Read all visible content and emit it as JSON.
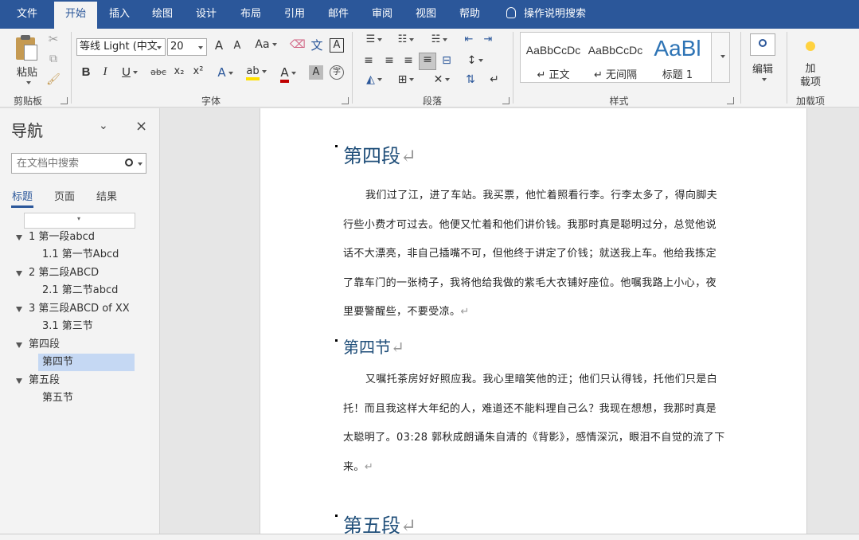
{
  "menu": {
    "tabs": [
      "文件",
      "开始",
      "插入",
      "绘图",
      "设计",
      "布局",
      "引用",
      "邮件",
      "审阅",
      "视图",
      "帮助"
    ],
    "active_tab": "开始",
    "tell_me": "操作说明搜索"
  },
  "ribbon": {
    "clipboard": {
      "paste_label": "粘贴",
      "group_label": "剪贴板"
    },
    "font": {
      "font_name": "等线 Light (中文",
      "font_size": "20",
      "grow": "A",
      "shrink": "A",
      "change_case": "Aa",
      "phonetic": "文",
      "border": "A",
      "bold": "B",
      "italic": "I",
      "underline": "U",
      "strikethrough": "abc",
      "subscript": "x₂",
      "superscript": "x²",
      "text_effects": "A",
      "highlight": "ab",
      "font_color": "A",
      "char_shading": "A",
      "enclose": "字",
      "group_label": "字体"
    },
    "paragraph": {
      "group_label": "段落"
    },
    "styles": {
      "items": [
        {
          "sample": "AaBbCcDc",
          "name": "↵ 正文"
        },
        {
          "sample": "AaBbCcDc",
          "name": "↵ 无间隔"
        },
        {
          "sample": "AaBl",
          "name": "标题 1"
        }
      ],
      "group_label": "样式"
    },
    "editing": {
      "label": "编辑"
    },
    "addins": {
      "label": "加\n载项",
      "label_line1": "加",
      "label_line2": "载项",
      "group_label": "加载项"
    }
  },
  "nav": {
    "title": "导航",
    "search_placeholder": "在文档中搜索",
    "tabs": [
      "标题",
      "页面",
      "结果"
    ],
    "active_tab": "标题",
    "items": [
      {
        "label": "1 第一段abcd",
        "level": 1,
        "expanded": true
      },
      {
        "label": "1.1 第一节Abcd",
        "level": 2
      },
      {
        "label": "2 第二段ABCD",
        "level": 1,
        "expanded": true
      },
      {
        "label": "2.1 第二节abcd",
        "level": 2
      },
      {
        "label": "3 第三段ABCD of XX",
        "level": 1,
        "expanded": true
      },
      {
        "label": "3.1 第三节",
        "level": 2
      },
      {
        "label": "第四段",
        "level": 1,
        "expanded": true
      },
      {
        "label": "第四节",
        "level": 2,
        "selected": true
      },
      {
        "label": "第五段",
        "level": 1,
        "expanded": true
      },
      {
        "label": "第五节",
        "level": 2
      }
    ]
  },
  "document": {
    "heading1": "第四段",
    "para1": "我们过了江，进了车站。我买票，他忙着照看行李。行李太多了，得向脚夫行些小费才可过去。他便又忙着和他们讲价钱。我那时真是聪明过分，总觉他说话不大漂亮，非自己插嘴不可，但他终于讲定了价钱；就送我上车。他给我拣定了靠车门的一张椅子，我将他给我做的紫毛大衣铺好座位。他嘱我路上小心，夜里要警醒些，不要受凉。",
    "heading2": "第四节",
    "para2": "又嘱托茶房好好照应我。我心里暗笑他的迂；他们只认得钱，托他们只是白托！而且我这样大年纪的人，难道还不能料理自己么？我现在想想，我那时真是太聪明了。03:28 郭秋成朗诵朱自清的《背影》，感情深沉，眼泪不自觉的流了下来。",
    "heading3": "第五段",
    "pilcrow": "↵"
  },
  "colors": {
    "accent": "#2b579a",
    "heading": "#1f4e79",
    "nav_selected": "#c5d8f3"
  }
}
